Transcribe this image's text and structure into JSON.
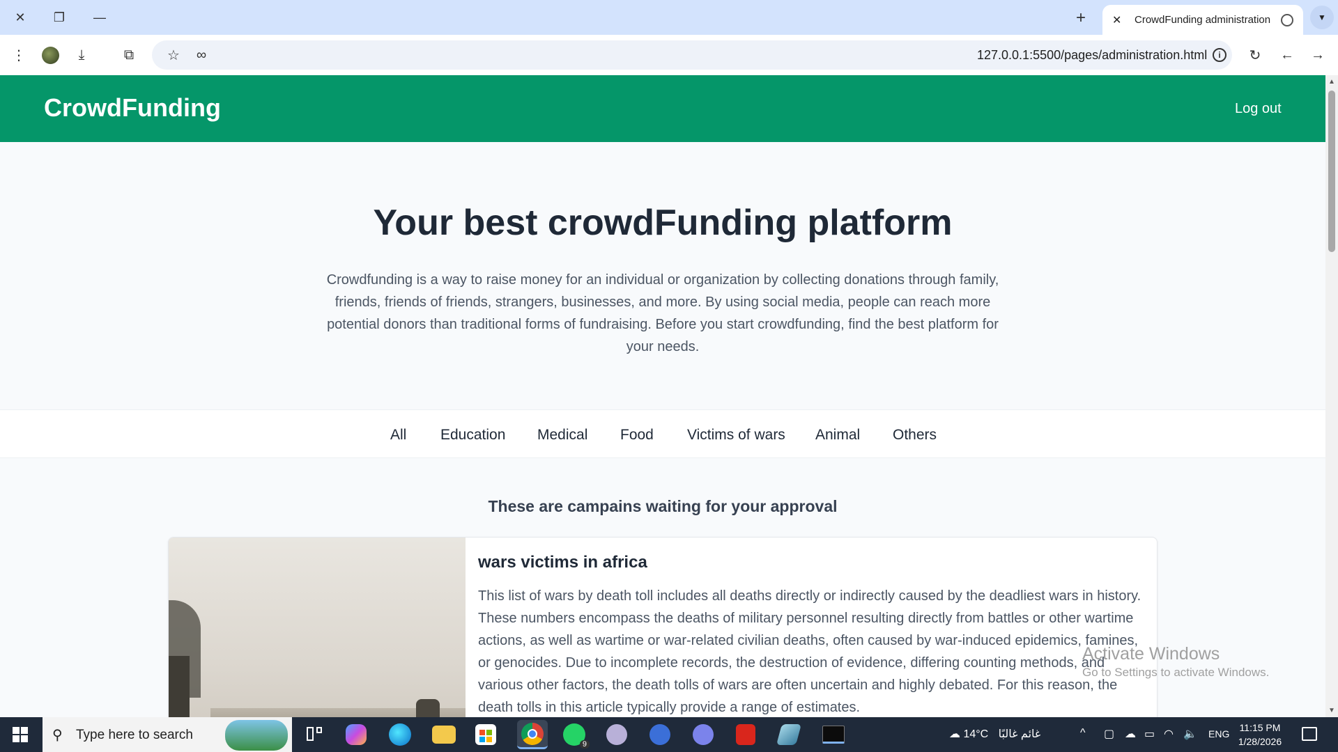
{
  "browser": {
    "tab_title": "CrowdFunding administration",
    "url": "127.0.0.1:5500/pages/administration.html"
  },
  "nav": {
    "brand": "CrowdFunding",
    "logout": "Log out"
  },
  "hero": {
    "title": "Your best crowdFunding platform",
    "text": "Crowdfunding is a way to raise money for an individual or organization by collecting donations through family, friends, friends of friends, strangers, businesses, and more. By using social media, people can reach more potential donors than traditional forms of fundraising. Before you start crowdfunding, find the best platform for your needs."
  },
  "categories": [
    {
      "label": "All"
    },
    {
      "label": "Education"
    },
    {
      "label": "Medical"
    },
    {
      "label": "Food"
    },
    {
      "label": "Victims of wars"
    },
    {
      "label": "Animal"
    },
    {
      "label": "Others"
    }
  ],
  "approval": {
    "title": "These are campains waiting for your approval"
  },
  "campaign": {
    "title": "wars victims in africa",
    "text": "This list of wars by death toll includes all deaths directly or indirectly caused by the deadliest wars in history. These numbers encompass the deaths of military personnel resulting directly from battles or other wartime actions, as well as wartime or war-related civilian deaths, often caused by war-induced epidemics, famines, or genocides. Due to incomplete records, the destruction of evidence, differing counting methods, and various other factors, the death tolls of wars are often uncertain and highly debated. For this reason, the death tolls in this article typically provide a range of estimates."
  },
  "watermark": {
    "line1": "Activate Windows",
    "line2": "Go to Settings to activate Windows."
  },
  "taskbar": {
    "search_placeholder": "Type here to search",
    "weather": "14°C",
    "weather_desc": "غائم غالبًا",
    "language": "ENG",
    "time": "11:15 PM",
    "date": "1/28/2026",
    "whatsapp_badge": "9"
  },
  "colors": {
    "navbar": "#059669",
    "titlebar": "#d3e3fd"
  }
}
